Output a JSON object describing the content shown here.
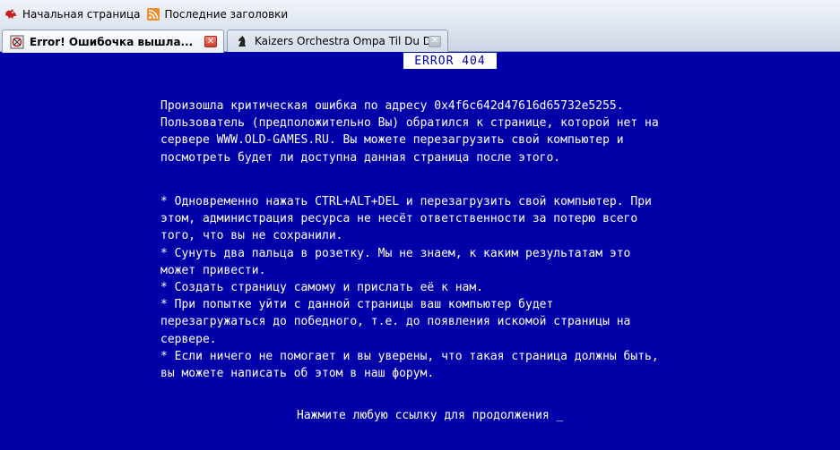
{
  "bookmarks": [
    {
      "label": "Начальная страница",
      "icon": "home-icon"
    },
    {
      "label": "Последние заголовки",
      "icon": "rss-icon"
    }
  ],
  "tabs": [
    {
      "title": "Error! Ошибочка вышла...",
      "active": true
    },
    {
      "title": "Kaizers Orchestra Ompa Til Du Dør ...",
      "active": false
    }
  ],
  "page": {
    "error_title": "ERROR 404",
    "paragraph1": "Произошла критическая ошибка по адресу 0x4f6c642d47616d65732e5255.\nПользователь (предположительно Вы) обратился к странице, которой нет на\nсервере WWW.OLD-GAMES.RU. Вы можете перезагрузить свой компьютер и\nпосмотреть будет ли доступна данная страница после этого.",
    "paragraph2": "* Одновременно нажать CTRL+ALT+DEL и перезагрузить свой компьютер. При\nэтом, администрация ресурса не несёт ответственности за потерю всего\nтого, что вы не сохранили.\n* Сунуть два пальца в розетку. Мы не знаем, к каким результатам это\nможет привести.\n* Создать страницу самому и прислать её к нам.\n* При попытке уйти с данной страницы ваш компьютер будет\nперезагружаться до победного, т.е. до появления искомой страницы на\nсервере.\n* Если ничего не помогает и вы уверены, что такая страница должны быть,\nвы можете написать об этом в наш форум.",
    "continue_text": "Нажмите любую ссылку для продолжения _"
  },
  "colors": {
    "background": "#0000a8",
    "text": "#ffffff"
  }
}
